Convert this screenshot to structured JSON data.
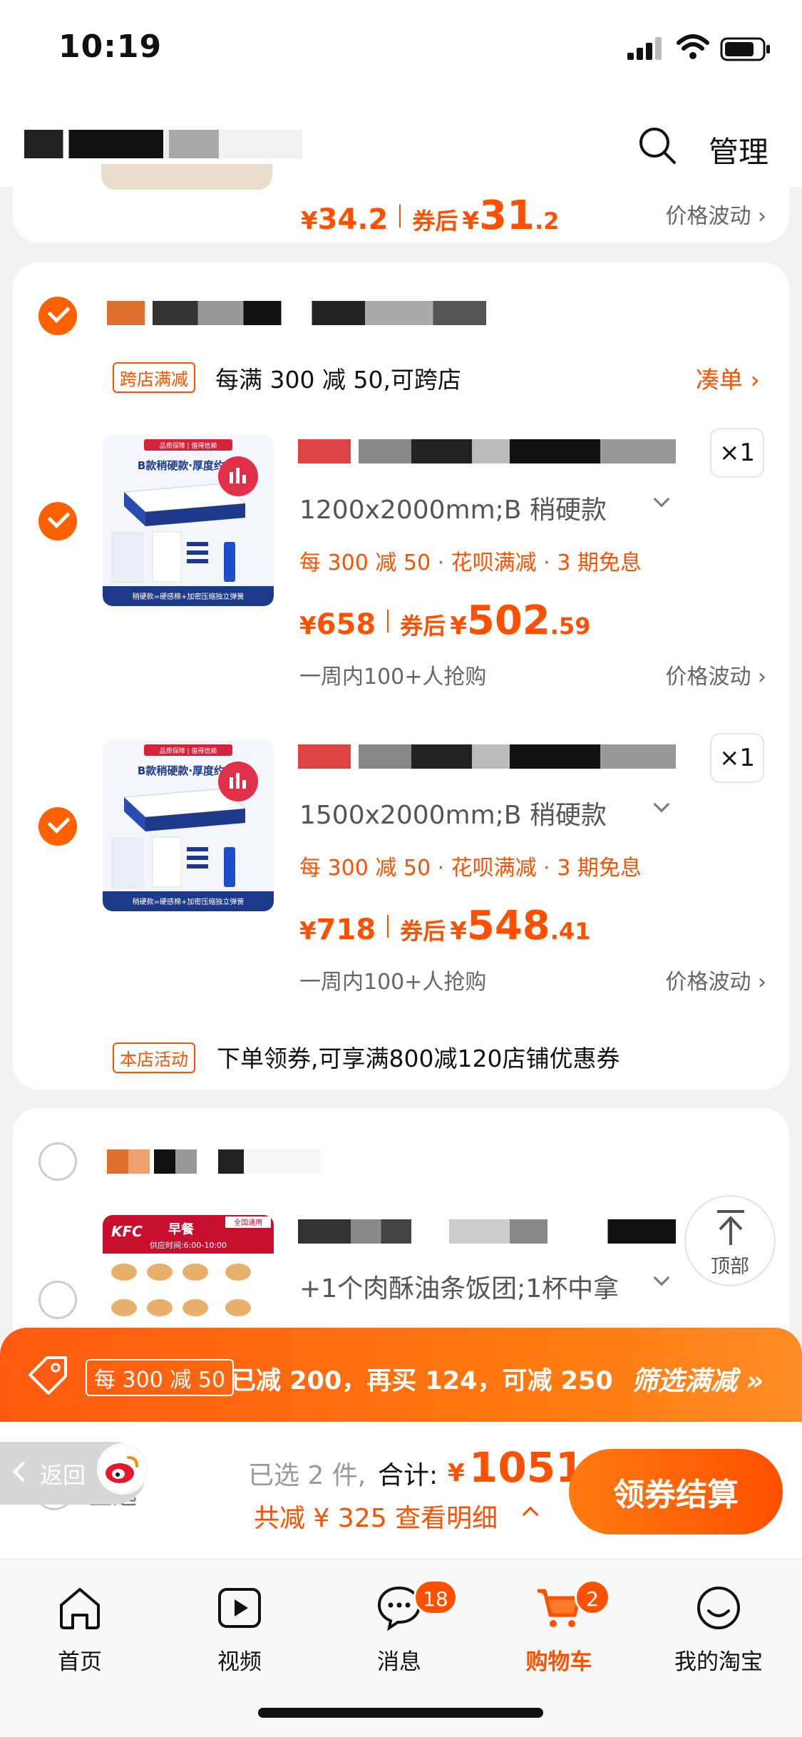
{
  "status_bar": {
    "time": "10:19"
  },
  "header": {
    "manage": "管理"
  },
  "cards": [
    {
      "price": "34.2",
      "after_label": "券后",
      "after_int": "31",
      "after_dec": ".2",
      "price_fluct": "价格波动"
    },
    {
      "promo_tag": "跨店满减",
      "promo_text": "每满 300 减 50,可跨店",
      "coudan": "凑单",
      "items": [
        {
          "sku": "1200x2000mm;B 稍硬款",
          "qty": "×1",
          "benefit": "每 300 减 50 · 花呗满减 · 3 期免息",
          "price": "658",
          "after_label": "券后",
          "after_int": "502",
          "after_dec": ".59",
          "hot": "一周内100+人抢购",
          "price_fluct": "价格波动"
        },
        {
          "sku": "1500x2000mm;B 稍硬款",
          "qty": "×1",
          "benefit": "每 300 减 50 · 花呗满减 · 3 期免息",
          "price": "718",
          "after_label": "券后",
          "after_int": "548",
          "after_dec": ".41",
          "hot": "一周内100+人抢购",
          "price_fluct": "价格波动"
        }
      ],
      "store_tag": "本店活动",
      "store_text": "下单领券,可享满800减120店铺优惠券",
      "image_text": {
        "badge": "品质保障 | 值得信赖",
        "title": "B款稍硬款·厚度约",
        "footer": "稍硬款=硬感棉+加密压缩独立弹簧"
      }
    },
    {
      "sku": "+1个肉酥油条饭团;1杯中拿",
      "image_text": {
        "brand": "KFC",
        "title": "早餐",
        "corner": "全国通用",
        "time": "供应时间:6:00-10:00"
      }
    }
  ],
  "back_to_top": "顶部",
  "promo_bar": {
    "tag": "每 300 减 50",
    "text": "已减 200，再买 124，可减 250",
    "filter": "筛选满减 »"
  },
  "checkout": {
    "back": "返回",
    "select_all": "全选",
    "selected": "已选 2 件,",
    "total_label": "合计:",
    "total_yen": "¥",
    "total": "1051",
    "reduced": "共减 ¥ 325  查看明细",
    "pay": "领券结算"
  },
  "tabs": [
    {
      "label": "首页",
      "icon": "home-icon"
    },
    {
      "label": "视频",
      "icon": "video-icon"
    },
    {
      "label": "消息",
      "icon": "message-icon",
      "badge": "18"
    },
    {
      "label": "购物车",
      "icon": "cart-icon",
      "badge": "2",
      "active": true
    },
    {
      "label": "我的淘宝",
      "icon": "profile-icon"
    }
  ],
  "colors": {
    "accent": "#ff5000",
    "background": "#f2f2f2"
  }
}
